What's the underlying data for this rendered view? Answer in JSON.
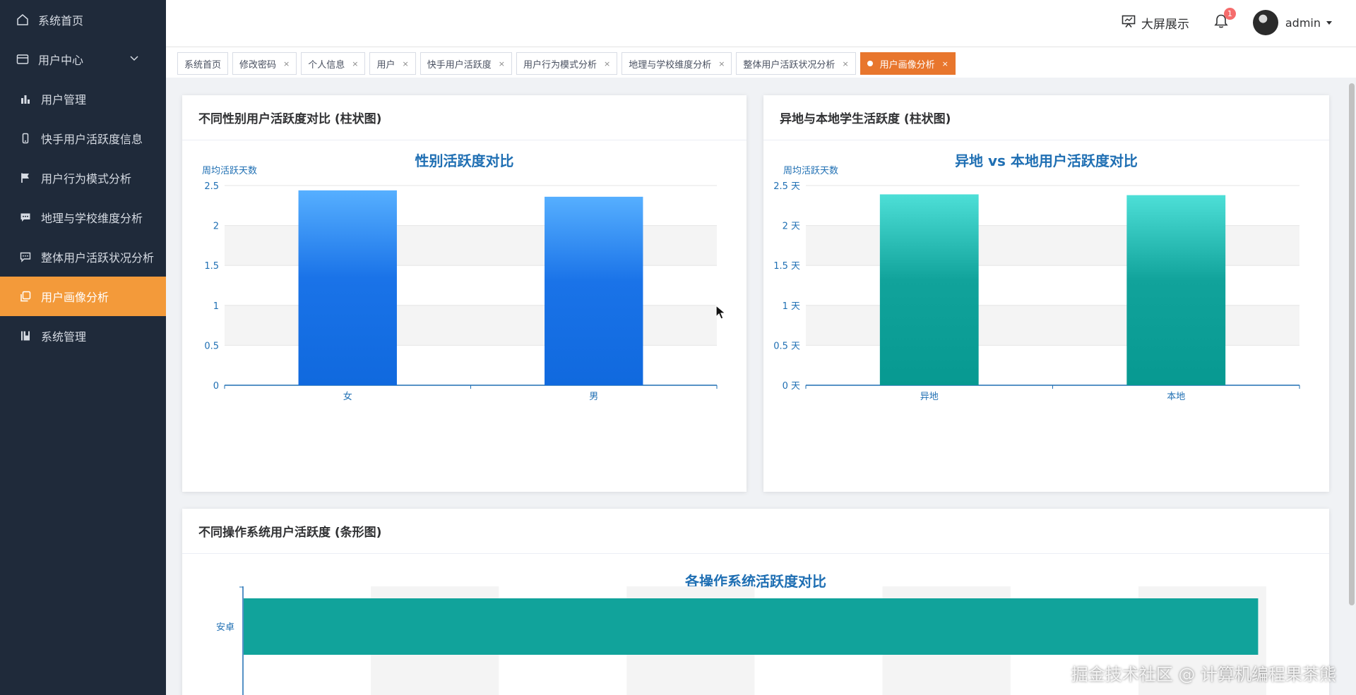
{
  "sidebar": {
    "items": [
      {
        "label": "系统首页",
        "icon": "home-icon"
      },
      {
        "label": "用户中心",
        "icon": "card-icon"
      },
      {
        "label": "用户管理",
        "icon": "bar-chart-icon"
      },
      {
        "label": "快手用户活跃度信息",
        "icon": "phone-icon"
      },
      {
        "label": "用户行为模式分析",
        "icon": "flag-icon"
      },
      {
        "label": "地理与学校维度分析",
        "icon": "message-icon"
      },
      {
        "label": "整体用户活跃状况分析",
        "icon": "chat-icon"
      },
      {
        "label": "用户画像分析",
        "icon": "copy-icon"
      },
      {
        "label": "系统管理",
        "icon": "book-icon"
      }
    ],
    "active_index": 7,
    "active_color": "#f39a3a"
  },
  "header": {
    "screen_label": "大屏展示",
    "notification_count": "1",
    "username": "admin"
  },
  "tags": [
    {
      "label": "系统首页",
      "closable": false
    },
    {
      "label": "修改密码",
      "closable": true
    },
    {
      "label": "个人信息",
      "closable": true
    },
    {
      "label": "用户",
      "closable": true
    },
    {
      "label": "快手用户活跃度",
      "closable": true
    },
    {
      "label": "用户行为模式分析",
      "closable": true
    },
    {
      "label": "地理与学校维度分析",
      "closable": true
    },
    {
      "label": "整体用户活跃状况分析",
      "closable": true
    },
    {
      "label": "用户画像分析",
      "closable": true,
      "active": true
    }
  ],
  "cards": {
    "gender": {
      "header": "不同性别用户活跃度对比 (柱状图)"
    },
    "region": {
      "header": "异地与本地学生活跃度 (柱状图)"
    },
    "os": {
      "header": "不同操作系统用户活跃度 (条形图)"
    }
  },
  "chart_data": [
    {
      "type": "bar",
      "title": "性别活跃度对比",
      "ylabel": "周均活跃天数",
      "categories": [
        "女",
        "男"
      ],
      "values": [
        2.44,
        2.36
      ],
      "ylim": [
        0,
        2.5
      ],
      "yticks": [
        "0",
        "0.5",
        "1",
        "1.5",
        "2",
        "2.5"
      ],
      "color": "#1a73e8",
      "grid": true
    },
    {
      "type": "bar",
      "title": "异地 vs 本地用户活跃度对比",
      "ylabel": "周均活跃天数",
      "categories": [
        "异地",
        "本地"
      ],
      "values": [
        2.39,
        2.38
      ],
      "ylim": [
        0,
        2.5
      ],
      "yticks": [
        "0 天",
        "0.5 天",
        "1 天",
        "1.5 天",
        "2 天",
        "2.5 天"
      ],
      "color": "#11a39b",
      "grid": true
    },
    {
      "type": "bar",
      "orientation": "horizontal",
      "title": "各操作系统活跃度对比",
      "categories": [
        "安卓"
      ],
      "values": [
        2.48
      ],
      "xlim": [
        0,
        2.5
      ],
      "color": "#11a39b",
      "grid": true
    }
  ],
  "watermark": "掘金技术社区 @ 计算机编程果茶熊"
}
